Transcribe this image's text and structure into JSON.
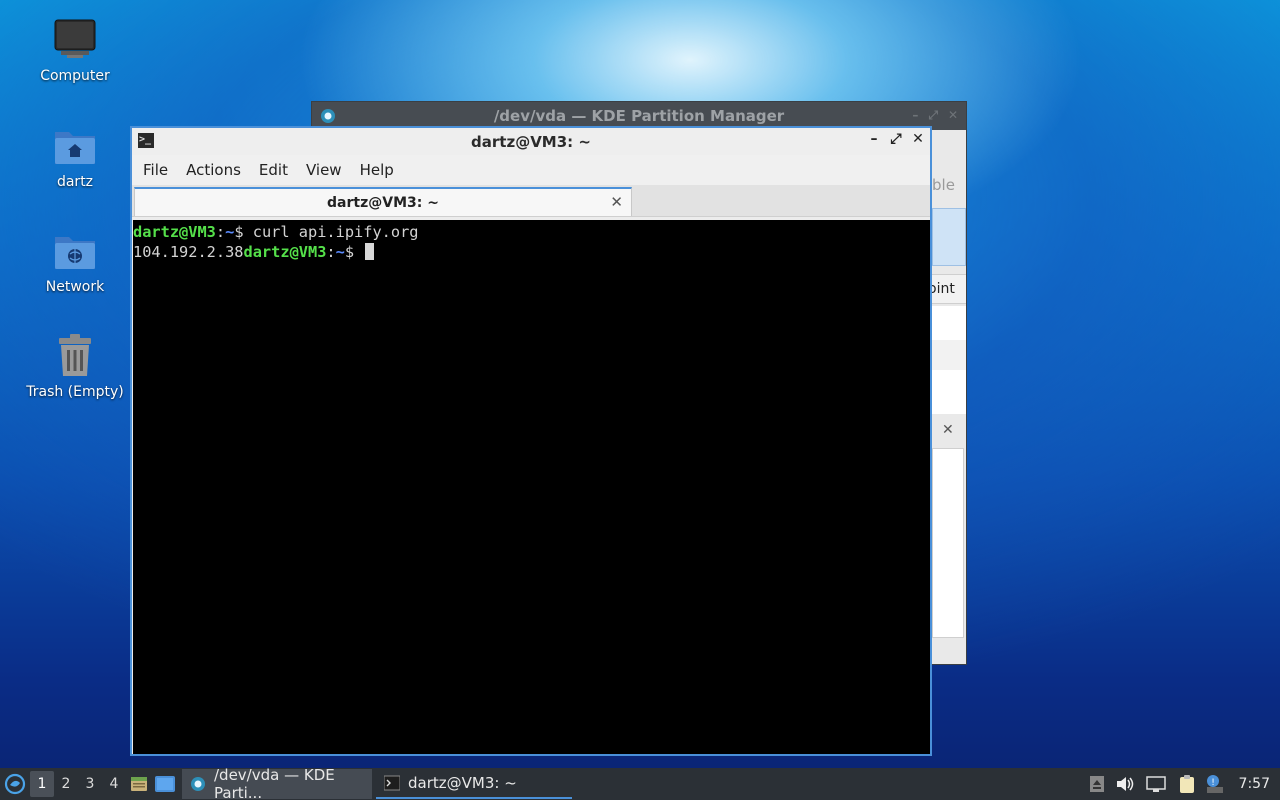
{
  "desktop": {
    "icons": [
      {
        "label": "Computer"
      },
      {
        "label": "dartz"
      },
      {
        "label": "Network"
      },
      {
        "label": "Trash (Empty)"
      }
    ]
  },
  "background_window": {
    "title": "/dev/vda — KDE Partition Manager",
    "peek_text_1": "ble",
    "peek_text_2": "oint"
  },
  "terminal": {
    "title": "dartz@VM3: ~",
    "menu": [
      "File",
      "Actions",
      "Edit",
      "View",
      "Help"
    ],
    "tab_label": "dartz@VM3: ~",
    "lines": [
      {
        "output": "",
        "user": "dartz@VM3",
        "sep": ":",
        "path": "~",
        "symbol": "$ ",
        "cmd": "curl api.ipify.org"
      },
      {
        "output": "104.192.2.38",
        "user": "dartz@VM3",
        "sep": ":",
        "path": "~",
        "symbol": "$ ",
        "cmd": ""
      }
    ]
  },
  "taskbar": {
    "workspaces": [
      "1",
      "2",
      "3",
      "4"
    ],
    "active_workspace": "1",
    "tasks": [
      {
        "label": "/dev/vda — KDE Parti...",
        "icon": "kde-partition-icon",
        "active": false
      },
      {
        "label": "dartz@VM3: ~",
        "icon": "terminal-icon",
        "active": true
      }
    ],
    "clock": "7:57"
  },
  "colors": {
    "prompt_user": "#55e04a",
    "prompt_path": "#5b8bff",
    "accent": "#4a90d9",
    "taskbar_bg": "#2b3036"
  }
}
